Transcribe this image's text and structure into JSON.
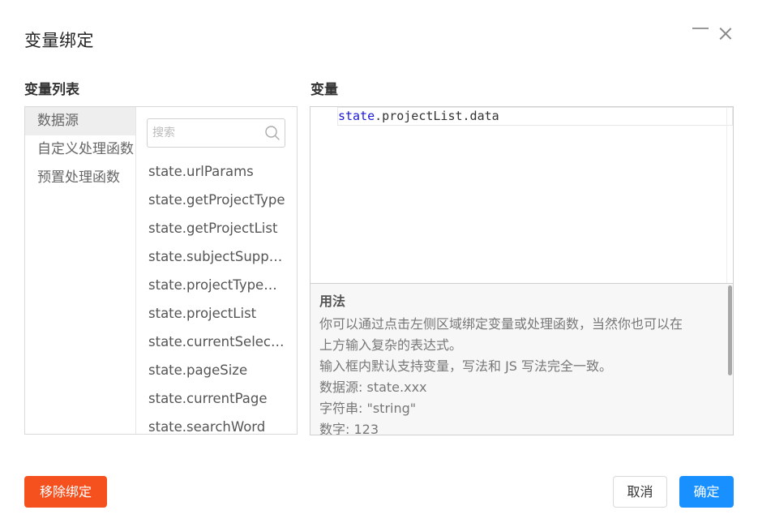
{
  "dialog": {
    "title": "变量绑定"
  },
  "left": {
    "section_label": "变量列表",
    "categories": [
      {
        "label": "数据源",
        "active": true
      },
      {
        "label": "自定义处理函数",
        "active": false
      },
      {
        "label": "预置处理函数",
        "active": false
      }
    ],
    "search": {
      "placeholder": "搜索",
      "value": ""
    },
    "variables": [
      "state.urlParams",
      "state.getProjectType",
      "state.getProjectList",
      "state.subjectSupport",
      "state.projectTypeOptions",
      "state.projectList",
      "state.currentSelectedProject",
      "state.pageSize",
      "state.currentPage",
      "state.searchWord"
    ]
  },
  "right": {
    "section_label": "变量",
    "editor": {
      "keyword": "state",
      "rest": ".projectList.data"
    },
    "usage": {
      "title": "用法",
      "lines": [
        "你可以通过点击左侧区域绑定变量或处理函数，当然你也可以在",
        "上方输入复杂的表达式。",
        "输入框内默认支持变量，写法和 JS 写法完全一致。",
        "数据源: state.xxx",
        "字符串: \"string\"",
        "数字: 123"
      ]
    }
  },
  "footer": {
    "remove_label": "移除绑定",
    "cancel_label": "取消",
    "ok_label": "确定"
  },
  "colors": {
    "remove_button": "#f5511e",
    "primary_button": "#1890ff",
    "keyword": "#1a1ad8"
  }
}
